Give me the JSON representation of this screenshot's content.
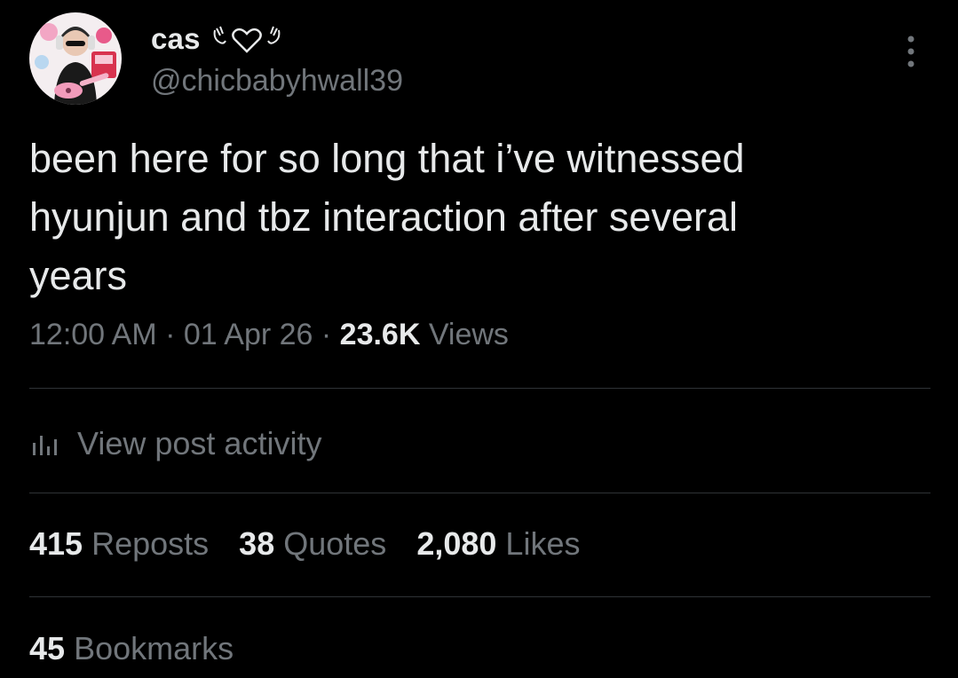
{
  "author": {
    "display_name": "cas",
    "name_emoji": "angel-heart-emoji",
    "handle": "@chicbabyhwall39",
    "avatar": "profile-photo"
  },
  "post": {
    "text": "been here for so long that i’ve witnessed\nhyunjun and tbz interaction after several\nyears"
  },
  "meta": {
    "time": "12:00 AM",
    "sep1": " · ",
    "date": "01 Apr 26",
    "sep2": " · ",
    "views_count": "23.6K",
    "views_label": "Views"
  },
  "activity": {
    "icon": "bar-chart-icon",
    "label": "View post activity"
  },
  "stats": {
    "reposts_count": "415",
    "reposts_label": "Reposts",
    "quotes_count": "38",
    "quotes_label": "Quotes",
    "likes_count": "2,080",
    "likes_label": "Likes",
    "bookmarks_count": "45",
    "bookmarks_label": "Bookmarks"
  },
  "colors": {
    "background": "#000000",
    "primary_text": "#e7e9ea",
    "secondary_text": "#71767b",
    "divider": "#2f3336"
  }
}
